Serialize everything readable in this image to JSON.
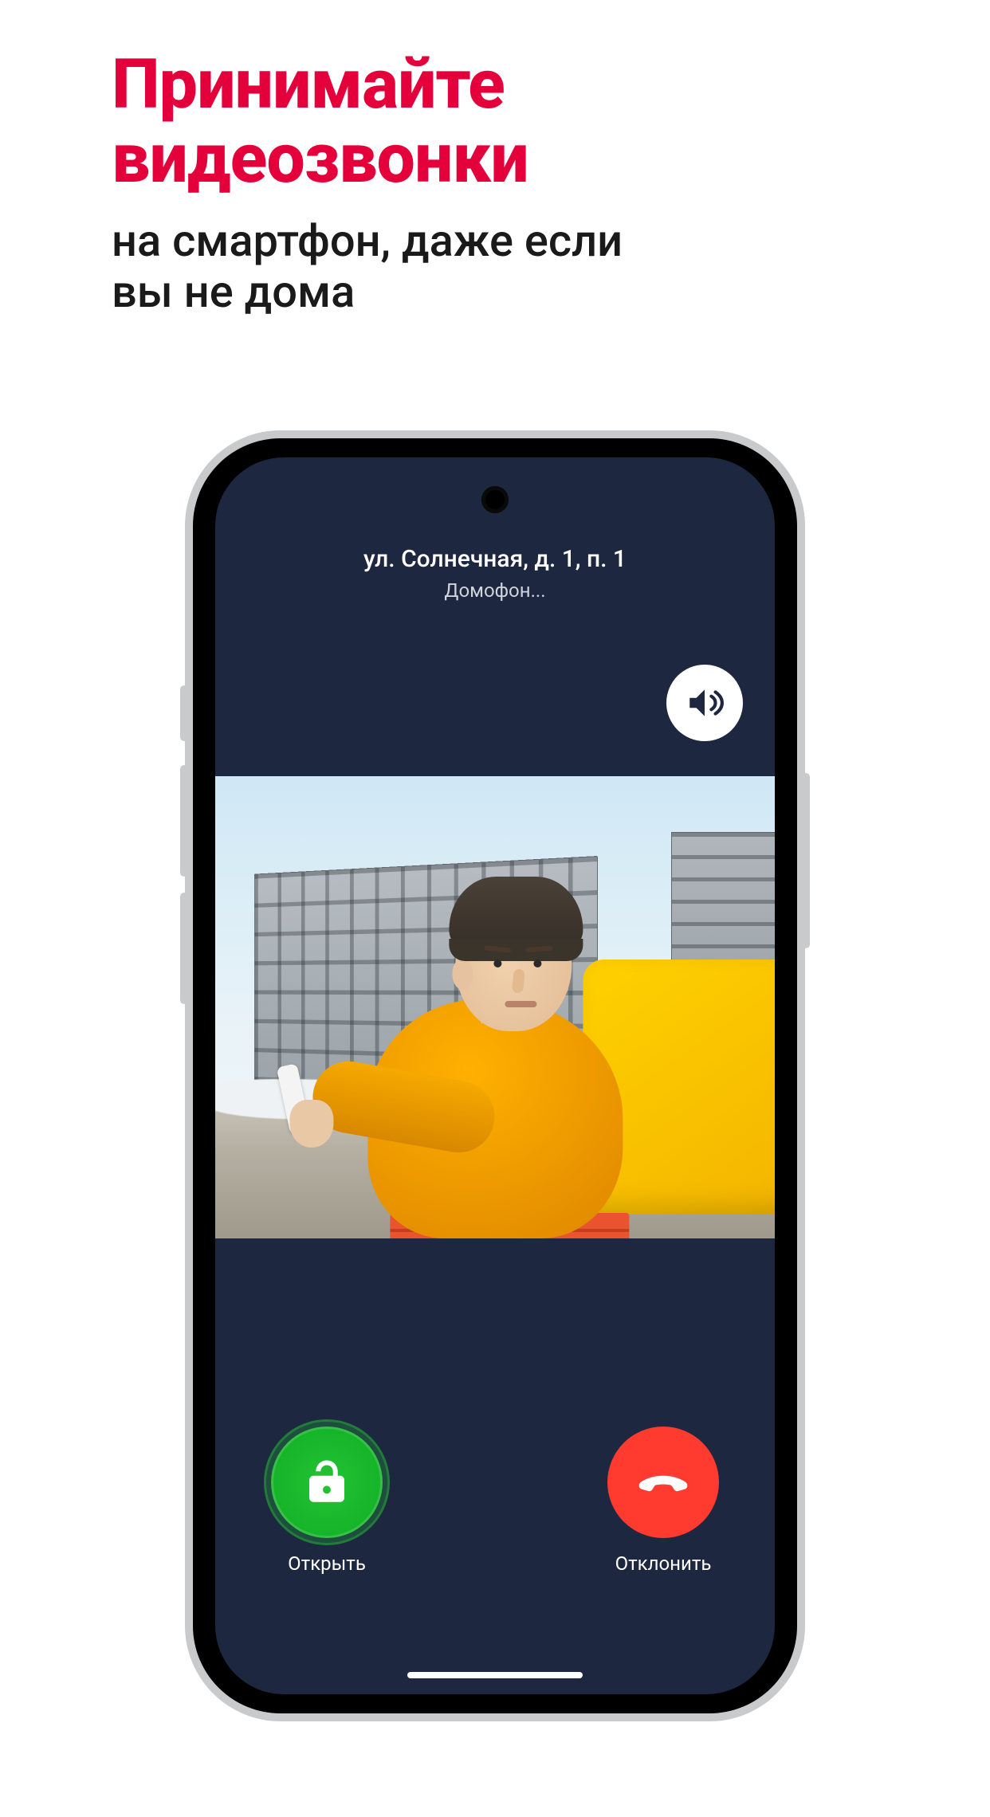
{
  "headline": {
    "title_line1": "Принимайте",
    "title_line2": "видеозвонки",
    "sub_line1": "на смартфон, даже если",
    "sub_line2": "вы не дома"
  },
  "call": {
    "address": "ул. Солнечная, д. 1, п. 1",
    "subtitle": "Домофон..."
  },
  "actions": {
    "open_label": "Открыть",
    "decline_label": "Отклонить"
  }
}
